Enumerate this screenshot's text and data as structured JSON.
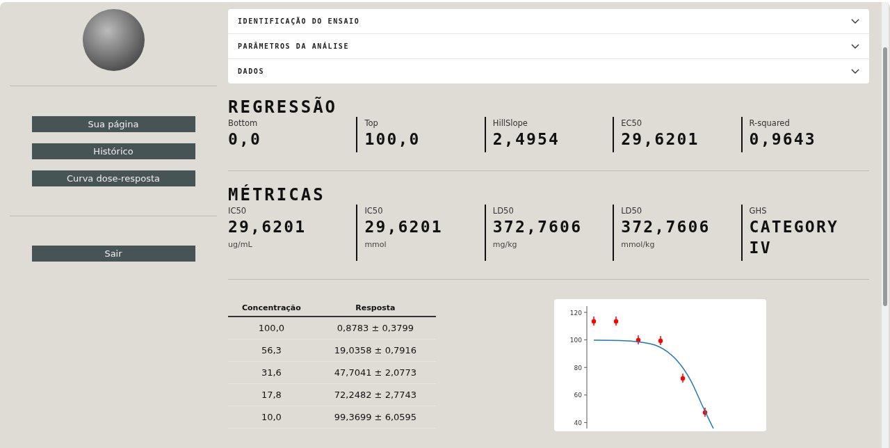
{
  "sidebar": {
    "nav": [
      {
        "label": "Sua página"
      },
      {
        "label": "Histórico"
      },
      {
        "label": "Curva dose-resposta"
      }
    ],
    "logout": {
      "label": "Sair"
    }
  },
  "accordion": [
    {
      "title": "IDENTIFICAÇÃO DO ENSAIO",
      "expanded": false
    },
    {
      "title": "PARÂMETROS DA ANÁLISE",
      "expanded": false
    },
    {
      "title": "DADOS",
      "expanded": false
    }
  ],
  "sections": [
    {
      "title": "REGRESSÃO",
      "metrics": [
        {
          "label": "Bottom",
          "value": "0,0"
        },
        {
          "label": "Top",
          "value": "100,0"
        },
        {
          "label": "HillSlope",
          "value": "2,4954"
        },
        {
          "label": "EC50",
          "value": "29,6201"
        },
        {
          "label": "R-squared",
          "value": "0,9643"
        }
      ]
    },
    {
      "title": "MÉTRICAS",
      "metrics": [
        {
          "label": "IC50",
          "value": "29,6201",
          "unit": "ug/mL"
        },
        {
          "label": "IC50",
          "value": "29,6201",
          "unit": "mmol"
        },
        {
          "label": "LD50",
          "value": "372,7606",
          "unit": "mg/kg"
        },
        {
          "label": "LD50",
          "value": "372,7606",
          "unit": "mmol/kg"
        },
        {
          "label": "GHS",
          "value": "CATEGORY IV"
        }
      ]
    }
  ],
  "table": {
    "columns": [
      "Concentração",
      "Resposta"
    ],
    "rows": [
      [
        "100,0",
        "0,8783 ± 0,3799"
      ],
      [
        "56,3",
        "19,0358 ± 0,7916"
      ],
      [
        "31,6",
        "47,7041 ± 2,0773"
      ],
      [
        "17,8",
        "72,2482 ± 2,7743"
      ],
      [
        "10,0",
        "99,3699 ± 6,0595"
      ]
    ]
  },
  "chart": {
    "y_tick_labels": [
      "120",
      "100",
      "80",
      "60",
      "40"
    ]
  }
}
